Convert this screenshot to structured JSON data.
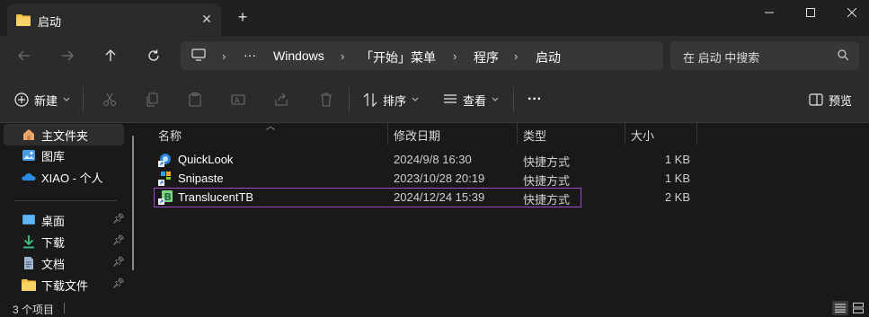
{
  "tab": {
    "title": "启动",
    "close": "✕"
  },
  "new_tab": "+",
  "nav": {
    "breadcrumbs": [
      "Windows",
      "「开始」菜单",
      "程序",
      "启动"
    ],
    "more": "···",
    "search_placeholder": "在 启动 中搜索"
  },
  "toolbar": {
    "new_label": "新建",
    "sort_label": "排序",
    "view_label": "查看",
    "more_label": "···",
    "preview_label": "预览"
  },
  "sidebar": {
    "items": [
      {
        "label": "主文件夹",
        "icon": "home-icon",
        "selected": true
      },
      {
        "label": "图库",
        "icon": "gallery-icon"
      },
      {
        "label": "XIAO - 个人",
        "icon": "onedrive-icon"
      },
      {
        "label": "桌面",
        "icon": "desktop-icon",
        "pinned": true
      },
      {
        "label": "下载",
        "icon": "download-icon",
        "pinned": true
      },
      {
        "label": "文档",
        "icon": "document-icon",
        "pinned": true
      },
      {
        "label": "下载文件",
        "icon": "folder-icon",
        "pinned": true
      }
    ]
  },
  "columns": {
    "name": "名称",
    "date": "修改日期",
    "type": "类型",
    "size": "大小"
  },
  "files": [
    {
      "name": "QuickLook",
      "date": "2024/9/8 16:30",
      "type": "快捷方式",
      "size": "1 KB",
      "icon": "quicklook-icon"
    },
    {
      "name": "Snipaste",
      "date": "2023/10/28 20:19",
      "type": "快捷方式",
      "size": "1 KB",
      "icon": "snipaste-icon"
    },
    {
      "name": "TranslucentTB",
      "date": "2024/12/24 15:39",
      "type": "快捷方式",
      "size": "2 KB",
      "icon": "translucenttb-icon",
      "highlighted": true
    }
  ],
  "status": {
    "count": "3 个项目"
  },
  "colors": {
    "accent": "#a349c7",
    "folder": "#f3c343",
    "background": "#191919",
    "chrome": "#2b2b2b"
  }
}
